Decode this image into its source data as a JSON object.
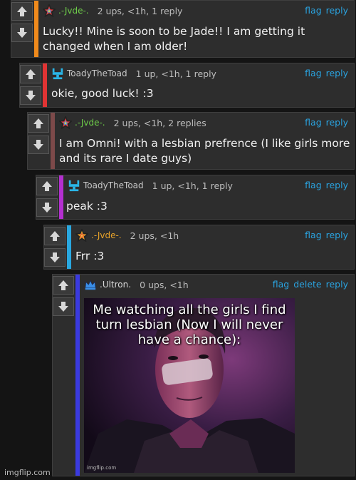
{
  "comments": [
    {
      "user": ".-Jvde-.",
      "meta": "2 ups, <1h, 1 reply",
      "text": "Lucky!! Mine is soon to be Jade!! I am getting it changed when I am older!",
      "actions": [
        "flag",
        "reply"
      ],
      "bar_color": "#f08a1c",
      "user_color": "#6fcf4a"
    },
    {
      "user": "ToadyTheToad",
      "meta": "1 up, <1h, 1 reply",
      "text": "okie, good luck! :3",
      "actions": [
        "flag",
        "reply"
      ],
      "bar_color": "#e13434",
      "user_color": "#c9c9c9"
    },
    {
      "user": ".-Jvde-.",
      "meta": "2 ups, <1h, 2 replies",
      "text": "I am Omni! with a lesbian prefrence (I like girls more and its rare I date guys)",
      "actions": [
        "flag",
        "reply"
      ],
      "bar_color": "#7d4a4a",
      "user_color": "#6fcf4a"
    },
    {
      "user": "ToadyTheToad",
      "meta": "1 up, <1h, 1 reply",
      "text": "peak :3",
      "actions": [
        "flag",
        "reply"
      ],
      "bar_color": "#b42fd0",
      "user_color": "#c9c9c9"
    },
    {
      "user": ".-Jvde-.",
      "meta": "2 ups, <1h",
      "text": "Frr :3",
      "actions": [
        "flag",
        "reply"
      ],
      "bar_color": "#29a8e0",
      "user_color": "#e8a32a"
    },
    {
      "user": ".Ultron.",
      "meta": "0 ups, <1h",
      "text": "",
      "actions": [
        "flag",
        "delete",
        "reply"
      ],
      "bar_color": "#3a3adf",
      "user_color": "#d8d8d8"
    }
  ],
  "meme_caption": "Me watching all the girls I find turn lesbian (Now I will never have a chance):",
  "meme_watermark": "imgflip.com",
  "footer": "imgflip.com",
  "icons": {
    "upvote": "arrow-up-icon",
    "downvote": "arrow-down-icon"
  }
}
